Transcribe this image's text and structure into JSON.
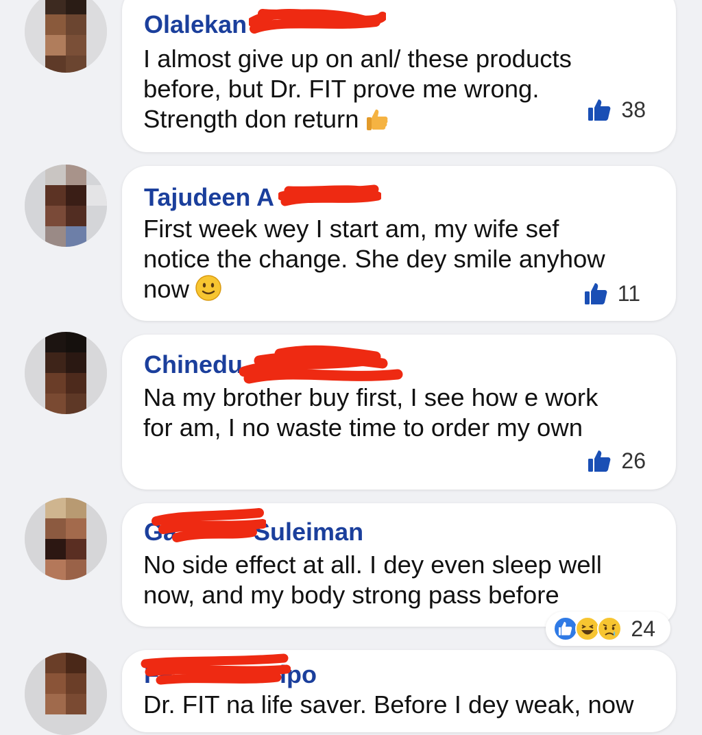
{
  "comments": [
    {
      "author": "Olalekan",
      "text_lines": [
        "I almost give up on anl/ these products",
        "before, but Dr. FIT prove me wrong.",
        "Strength don return"
      ],
      "emoji": "thumbs-up-emoji",
      "likes": "38"
    },
    {
      "author": "Tajudeen A",
      "text_lines": [
        "First week wey I start am, my wife sef",
        "notice the change. She dey smile anyhow",
        "now"
      ],
      "emoji": "smiling-face-emoji",
      "likes": "11"
    },
    {
      "author": "Chinedu",
      "text_lines": [
        "Na my brother buy first, I see how e work",
        "for am, I no waste time to order my own"
      ],
      "likes": "26"
    },
    {
      "author_prefix": "Ga",
      "author": "Suleiman",
      "text_lines": [
        "No side effect at all. I dey even sleep well",
        "now, and my body strong pass before"
      ],
      "reactions": [
        "like-reaction-icon",
        "laugh-reaction-icon",
        "sad-reaction-icon"
      ],
      "likes": "24"
    },
    {
      "author_prefix": "Fe",
      "author": "ipo",
      "text_lines": [
        "Dr. FIT na life saver. Before I dey weak, now"
      ]
    }
  ],
  "colors": {
    "author": "#1b3f9c",
    "like_icon": "#1a4fb5",
    "redaction": "#ee2a12",
    "background": "#f0f1f4"
  }
}
